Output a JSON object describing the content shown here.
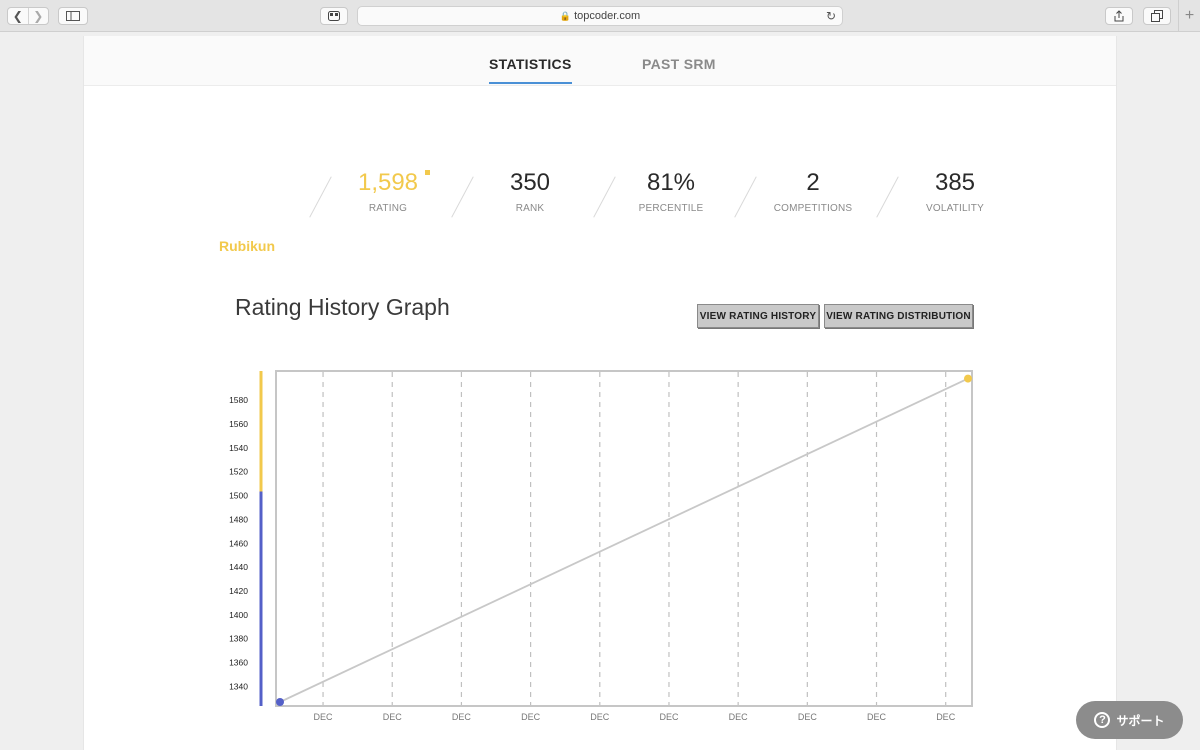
{
  "browser": {
    "url": "topcoder.com",
    "lock_icon": "lock-icon",
    "reload_icon": "reload-icon"
  },
  "tabs": [
    {
      "label": "STATISTICS",
      "active": true
    },
    {
      "label": "PAST SRM",
      "active": false
    }
  ],
  "stats": [
    {
      "value": "1,598",
      "label": "RATING"
    },
    {
      "value": "350",
      "label": "RANK"
    },
    {
      "value": "81%",
      "label": "PERCENTILE"
    },
    {
      "value": "2",
      "label": "COMPETITIONS"
    },
    {
      "value": "385",
      "label": "VOLATILITY"
    }
  ],
  "handle": "Rubikun",
  "graph": {
    "title": "Rating History Graph",
    "buttons": {
      "history": "VIEW RATING HISTORY",
      "distribution": "VIEW RATING DISTRIBUTION"
    }
  },
  "support": {
    "label": "サポート"
  },
  "colors": {
    "yellow": "#f2c94c",
    "blue": "#5460c8",
    "tab_underline": "#4a90d6",
    "line": "#c8c8c8"
  },
  "chart_data": {
    "type": "line",
    "title": "Rating History Graph",
    "xlabel": "",
    "ylabel": "",
    "x_ticks": [
      "DEC",
      "DEC",
      "DEC",
      "DEC",
      "DEC",
      "DEC",
      "DEC",
      "DEC",
      "DEC",
      "DEC"
    ],
    "y_ticks": [
      1580,
      1560,
      1540,
      1520,
      1500,
      1480,
      1460,
      1440,
      1420,
      1400,
      1380,
      1360,
      1340
    ],
    "ylim": [
      1327,
      1601
    ],
    "series": [
      {
        "values": [
          {
            "x": 0,
            "y": 1327
          },
          {
            "x": 1,
            "y": 1598
          }
        ]
      }
    ],
    "rating_bands": [
      {
        "from": 1500,
        "to": 1601,
        "color": "#f2c94c"
      },
      {
        "from": 1327,
        "to": 1500,
        "color": "#5460c8"
      }
    ],
    "grid": "vertical dashed"
  }
}
